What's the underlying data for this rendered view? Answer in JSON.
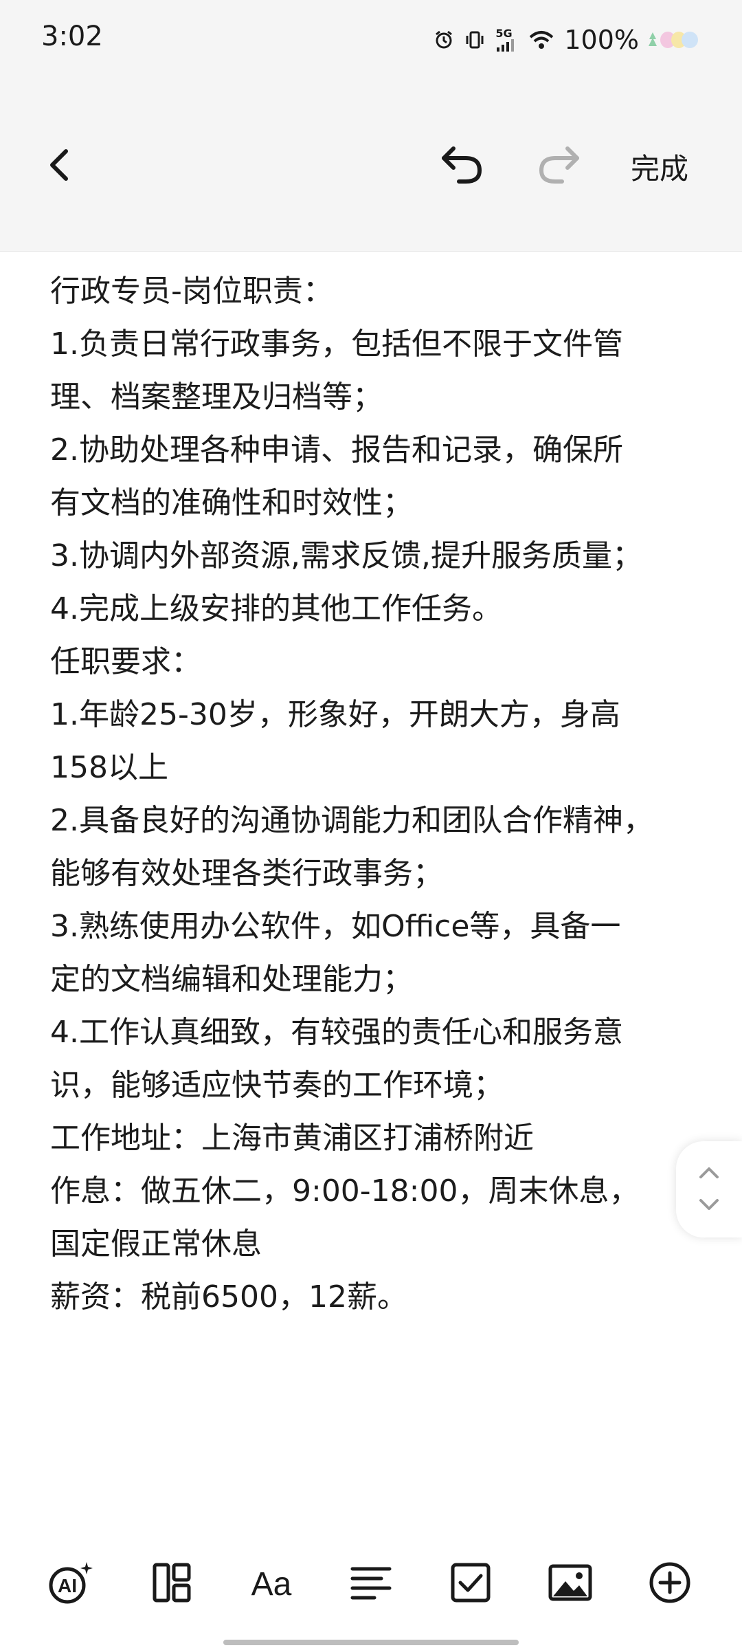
{
  "status_bar": {
    "time": "3:02",
    "network": "5G",
    "battery": "100%"
  },
  "header": {
    "done_label": "完成"
  },
  "note": {
    "lines": [
      "行政专员-岗位职责：",
      "1.负责日常行政事务，包括但不限于文件管",
      "理、档案整理及归档等；",
      "2.协助处理各种申请、报告和记录，确保所",
      "有文档的准确性和时效性；",
      "3.协调内外部资源,需求反馈,提升服务质量；",
      "4.完成上级安排的其他工作任务。",
      "任职要求：",
      "1.年龄25-30岁，形象好，开朗大方，身高",
      "158以上",
      "2.具备良好的沟通协调能力和团队合作精神，",
      "能够有效处理各类行政事务；",
      "3.熟练使用办公软件，如Office等，具备一",
      "定的文档编辑和处理能力；",
      "4.工作认真细致，有较强的责任心和服务意",
      "识，能够适应快节奏的工作环境；",
      "工作地址：上海市黄浦区打浦桥附近",
      "作息：做五休二，9:00-18:00，周末休息，",
      "国定假正常休息",
      "薪资：税前6500，12薪。"
    ]
  },
  "toolbar": {
    "ai_label": "AI",
    "font_label": "Aa"
  },
  "colors": {
    "header_bg": "#f5f5f5",
    "text": "#1a1a1a",
    "disabled": "#b0b0b0"
  }
}
